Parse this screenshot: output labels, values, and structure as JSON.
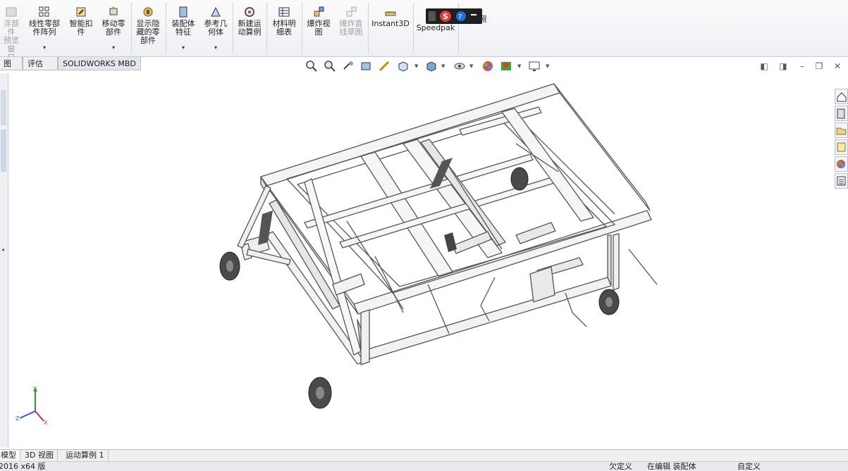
{
  "ribbon": {
    "buttons": [
      {
        "label": "浮部件\n预览窗\n口",
        "disabled": true
      },
      {
        "label": "线性零部\n件阵列",
        "dropdown": "▾"
      },
      {
        "label": "智能扣\n件",
        "dropdown": ""
      },
      {
        "label": "移动零\n部件",
        "dropdown": "▾"
      },
      {
        "label": "显示隐\n藏的零\n部件",
        "dropdown": ""
      },
      {
        "label": "装配体\n特征",
        "dropdown": "▾"
      },
      {
        "label": "参考几\n何体",
        "dropdown": "▾"
      },
      {
        "label": "新建运\n动算例",
        "dropdown": ""
      },
      {
        "label": "材料明\n细表",
        "dropdown": ""
      },
      {
        "label": "爆炸视\n图",
        "dropdown": ""
      },
      {
        "label": "爆炸直\n线草图",
        "disabled": true
      },
      {
        "label": "Instant3D",
        "dropdown": ""
      },
      {
        "label": "更新\nSpeedpak",
        "dropdown": ""
      },
      {
        "label": "拍快照",
        "dropdown": ""
      }
    ]
  },
  "tabs": [
    {
      "label": "图"
    },
    {
      "label": "评估"
    },
    {
      "label": "SOLIDWORKS MBD"
    }
  ],
  "bottom_tabs": [
    {
      "label": "模型"
    },
    {
      "label": "3D 视图"
    },
    {
      "label": "运动算例 1"
    }
  ],
  "status": {
    "version": "2016 x64 版",
    "defined": "欠定义",
    "editing": "在编辑 装配体",
    "custom": "自定义"
  },
  "triad": {
    "x": "X",
    "y": "Y",
    "z": "Z"
  },
  "colors": {
    "ribbon_bg": "#eef0f2",
    "accent": "#1e6fd9",
    "model_line": "#555555"
  }
}
